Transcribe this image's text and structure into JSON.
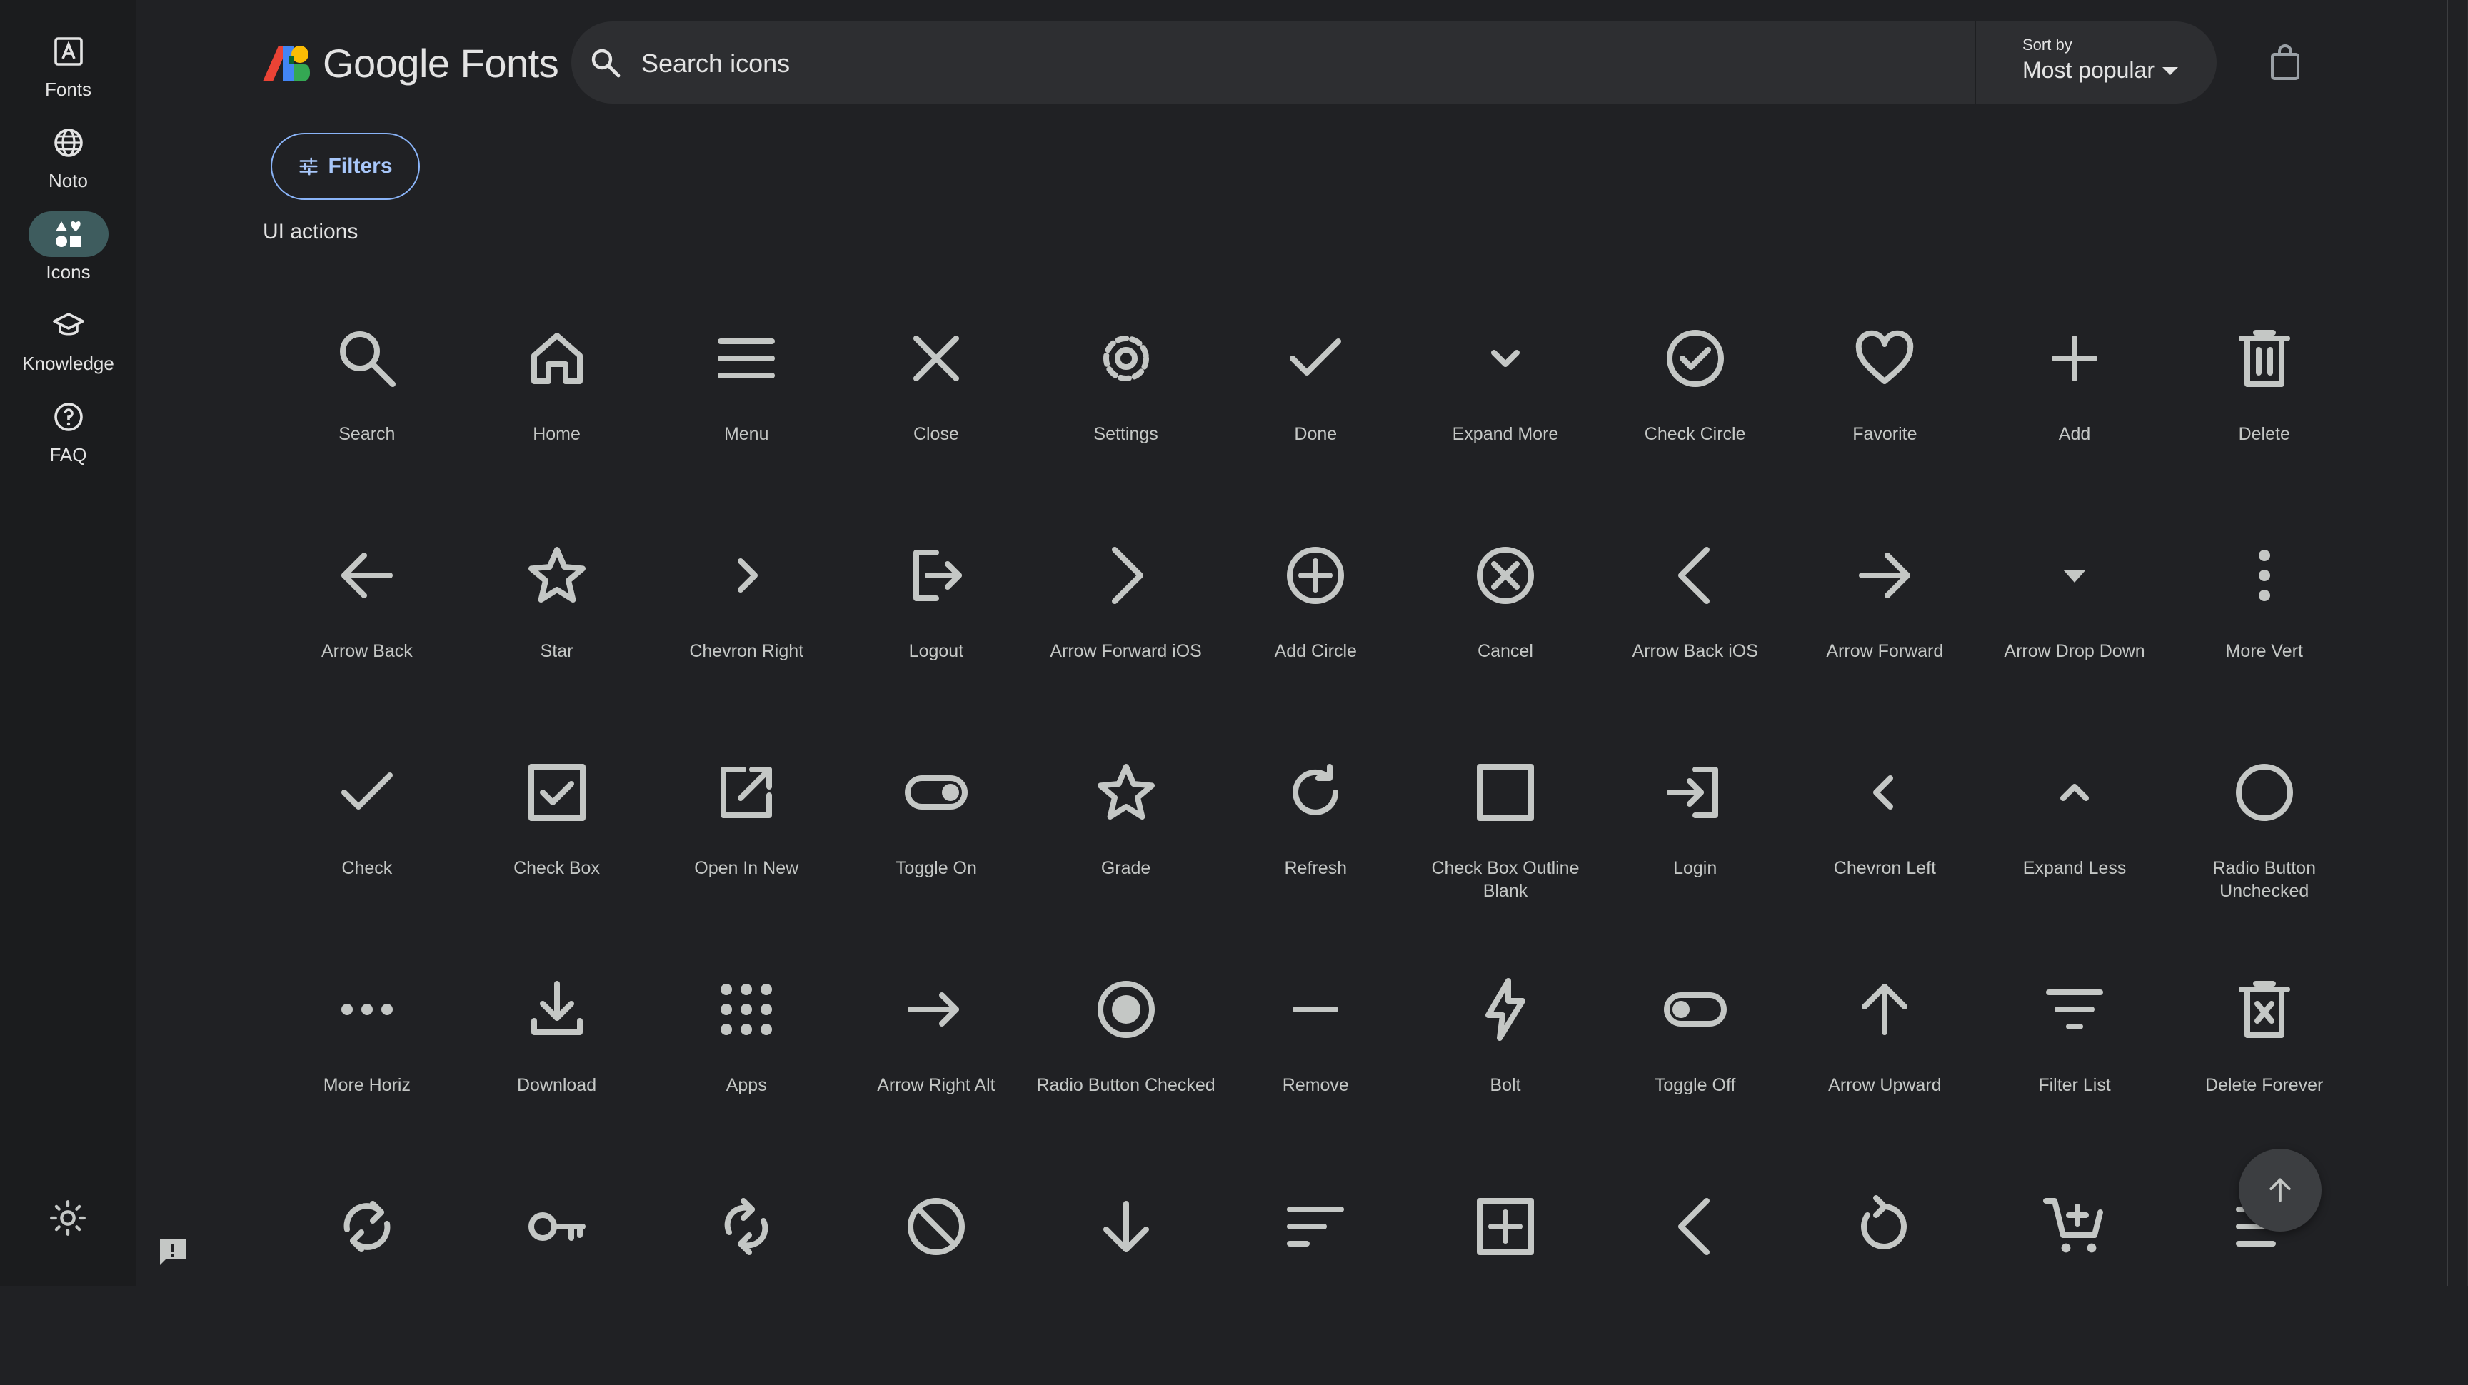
{
  "brand": {
    "name": "Google Fonts"
  },
  "colors": {
    "background": "#202124",
    "rail": "#1b1c1e",
    "accent": "#8ab4f8",
    "icon": "#c4c7c5",
    "active_pill": "#3e5c5e"
  },
  "rail": [
    {
      "label": "Fonts",
      "icon": "fonts-icon",
      "active": false
    },
    {
      "label": "Noto",
      "icon": "globe-icon",
      "active": false
    },
    {
      "label": "Icons",
      "icon": "shapes-icon",
      "active": true
    },
    {
      "label": "Knowledge",
      "icon": "school-icon",
      "active": false
    },
    {
      "label": "FAQ",
      "icon": "help-icon",
      "active": false
    }
  ],
  "search": {
    "placeholder": "Search icons",
    "value": ""
  },
  "sort": {
    "label": "Sort by",
    "value": "Most popular"
  },
  "filters_label": "Filters",
  "section_title": "UI actions",
  "icons": [
    {
      "name": "Search",
      "icon": "search-icon"
    },
    {
      "name": "Home",
      "icon": "home-icon"
    },
    {
      "name": "Menu",
      "icon": "menu-icon"
    },
    {
      "name": "Close",
      "icon": "close-icon"
    },
    {
      "name": "Settings",
      "icon": "settings-icon"
    },
    {
      "name": "Done",
      "icon": "done-icon"
    },
    {
      "name": "Expand More",
      "icon": "expand-more-icon"
    },
    {
      "name": "Check Circle",
      "icon": "check-circle-icon"
    },
    {
      "name": "Favorite",
      "icon": "favorite-icon"
    },
    {
      "name": "Add",
      "icon": "add-icon"
    },
    {
      "name": "Delete",
      "icon": "delete-icon"
    },
    {
      "name": "Arrow Back",
      "icon": "arrow-back-icon"
    },
    {
      "name": "Star",
      "icon": "star-icon"
    },
    {
      "name": "Chevron Right",
      "icon": "chevron-right-icon"
    },
    {
      "name": "Logout",
      "icon": "logout-icon"
    },
    {
      "name": "Arrow Forward iOS",
      "icon": "arrow-forward-ios-icon"
    },
    {
      "name": "Add Circle",
      "icon": "add-circle-icon"
    },
    {
      "name": "Cancel",
      "icon": "cancel-icon"
    },
    {
      "name": "Arrow Back iOS",
      "icon": "arrow-back-ios-icon"
    },
    {
      "name": "Arrow Forward",
      "icon": "arrow-forward-icon"
    },
    {
      "name": "Arrow Drop Down",
      "icon": "arrow-drop-down-icon"
    },
    {
      "name": "More Vert",
      "icon": "more-vert-icon"
    },
    {
      "name": "Check",
      "icon": "check-icon"
    },
    {
      "name": "Check Box",
      "icon": "check-box-icon"
    },
    {
      "name": "Open In New",
      "icon": "open-in-new-icon"
    },
    {
      "name": "Toggle On",
      "icon": "toggle-on-icon"
    },
    {
      "name": "Grade",
      "icon": "grade-icon"
    },
    {
      "name": "Refresh",
      "icon": "refresh-icon"
    },
    {
      "name": "Check Box Outline Blank",
      "icon": "check-box-outline-blank-icon"
    },
    {
      "name": "Login",
      "icon": "login-icon"
    },
    {
      "name": "Chevron Left",
      "icon": "chevron-left-icon"
    },
    {
      "name": "Expand Less",
      "icon": "expand-less-icon"
    },
    {
      "name": "Radio Button Unchecked",
      "icon": "radio-button-unchecked-icon"
    },
    {
      "name": "More Horiz",
      "icon": "more-horiz-icon"
    },
    {
      "name": "Download",
      "icon": "download-icon"
    },
    {
      "name": "Apps",
      "icon": "apps-icon"
    },
    {
      "name": "Arrow Right Alt",
      "icon": "arrow-right-alt-icon"
    },
    {
      "name": "Radio Button Checked",
      "icon": "radio-button-checked-icon"
    },
    {
      "name": "Remove",
      "icon": "remove-icon"
    },
    {
      "name": "Bolt",
      "icon": "bolt-icon"
    },
    {
      "name": "Toggle Off",
      "icon": "toggle-off-icon"
    },
    {
      "name": "Arrow Upward",
      "icon": "arrow-upward-icon"
    },
    {
      "name": "Filter List",
      "icon": "filter-list-icon"
    },
    {
      "name": "Delete Forever",
      "icon": "delete-forever-icon"
    },
    {
      "name": "",
      "icon": "sync-icon"
    },
    {
      "name": "",
      "icon": "key-icon"
    },
    {
      "name": "",
      "icon": "sync-alt-icon"
    },
    {
      "name": "",
      "icon": "block-icon"
    },
    {
      "name": "",
      "icon": "arrow-downward-icon"
    },
    {
      "name": "",
      "icon": "sort-icon"
    },
    {
      "name": "",
      "icon": "add-box-icon"
    },
    {
      "name": "",
      "icon": "arrow-back-ios-new-icon"
    },
    {
      "name": "",
      "icon": "replay-icon"
    },
    {
      "name": "",
      "icon": "add-shopping-cart-icon"
    },
    {
      "name": "",
      "icon": "clear-all-icon"
    }
  ]
}
